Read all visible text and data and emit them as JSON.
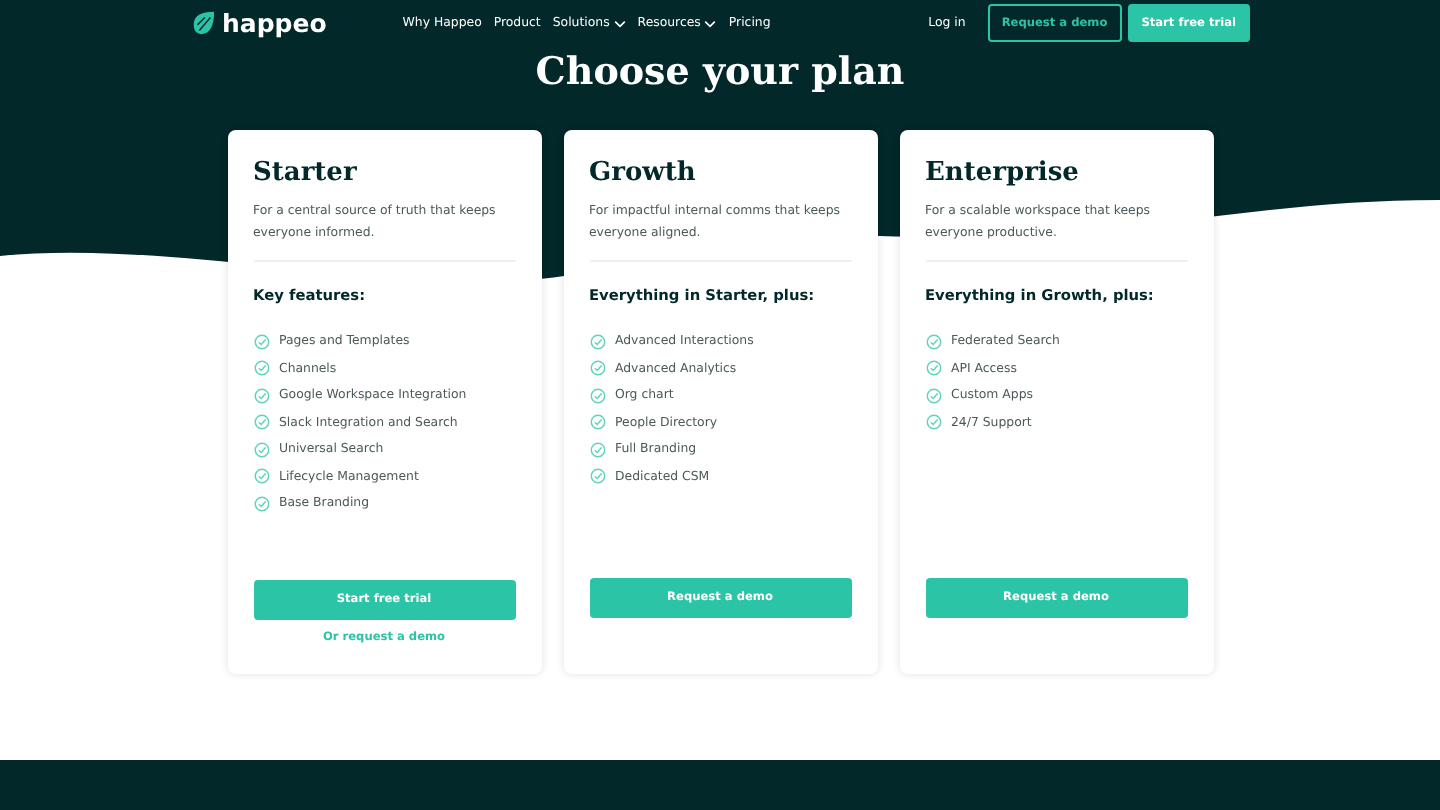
{
  "nav": {
    "logo": "happeo",
    "links": [
      {
        "label": "Why Happeo",
        "dropdown": false
      },
      {
        "label": "Product",
        "dropdown": false
      },
      {
        "label": "Solutions",
        "dropdown": true
      },
      {
        "label": "Resources",
        "dropdown": true
      },
      {
        "label": "Pricing",
        "dropdown": false
      }
    ],
    "login": "Log in",
    "buttons": [
      {
        "label": "Request a demo",
        "kind": "outline"
      },
      {
        "label": "Start free trial",
        "kind": "solid"
      }
    ]
  },
  "heading": "Choose your plan",
  "plans": [
    {
      "name": "Starter",
      "description": "For a central source of truth that keeps everyone informed.",
      "features_heading": "Key features:",
      "features": [
        "Pages and Templates",
        "Channels",
        "Google Workspace Integration",
        "Slack Integration and Search",
        "Universal Search",
        "Lifecycle Management",
        "Base Branding"
      ],
      "actions": [
        {
          "kind": "button",
          "label": "Start free trial"
        },
        {
          "kind": "link",
          "label": "Or request a demo"
        }
      ]
    },
    {
      "name": "Growth",
      "description": "For impactful internal comms that keeps everyone aligned.",
      "features_heading": "Everything in Starter, plus:",
      "features": [
        "Advanced Interactions",
        "Advanced Analytics",
        "Org chart",
        "People Directory",
        "Full Branding",
        "Dedicated CSM"
      ],
      "actions": [
        {
          "kind": "button",
          "label": "Request a demo"
        }
      ]
    },
    {
      "name": "Enterprise",
      "description": "For a scalable workspace that keeps everyone productive.",
      "features_heading": "Everything in Growth, plus:",
      "features": [
        "Federated Search",
        "API Access",
        "Custom Apps",
        "24/7 Support"
      ],
      "actions": [
        {
          "kind": "button",
          "label": "Request a demo"
        }
      ]
    }
  ]
}
